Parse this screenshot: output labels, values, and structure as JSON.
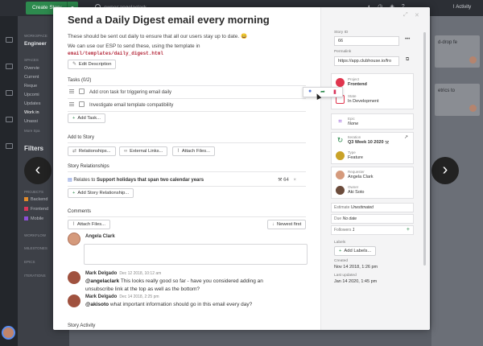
{
  "topbar": {
    "create_label": "Create Story",
    "search_query": "owner:angelaclark",
    "activity_label": "Activity"
  },
  "sidebar": {
    "workspace_heading": "WORKSPACE",
    "workspace_name": "Engineer",
    "spaces_heading": "SPACES",
    "spaces": [
      "Overvie",
      "Current",
      "Reque",
      "Upcomi",
      "Updates",
      "Work in",
      "Unassi",
      "More Spa"
    ],
    "filters_heading": "Filters",
    "projects_heading": "PROJECTS",
    "projects": [
      {
        "label": "Backend",
        "color": "#e08a2c"
      },
      {
        "label": "Frontend",
        "color": "#d9355b"
      },
      {
        "label": "Mobile",
        "color": "#8c4fd6"
      }
    ],
    "collapsed_headings": [
      "WORKFLOW",
      "MILESTONES",
      "EPICS",
      "ITERATIONS"
    ]
  },
  "board": {
    "cards": [
      {
        "text": "d-drop fe"
      },
      {
        "text": "etrics to"
      }
    ]
  },
  "story": {
    "title": "Send a Daily Digest email every morning",
    "description_line1": "These should be sent out daily to ensure that all our users stay up to date. 😀",
    "description_line2": "We can use our ESP to send these, using the template in",
    "description_code": "email/templates/daily_digest.html",
    "edit_description_label": "Edit Description",
    "tasks_heading": "Tasks (0/2)",
    "tasks": [
      {
        "label": "Add cron task for triggering email daily"
      },
      {
        "label": "Investigate email template compatibility"
      }
    ],
    "add_task_label": "Add Task...",
    "add_to_story_heading": "Add to Story",
    "add_to_story_buttons": [
      "Relationships...",
      "External Links...",
      "Attach Files..."
    ],
    "relationships_heading": "Story Relationships",
    "relationship": {
      "prefix": "Relates to",
      "target": "Support holidays that span two calendar years",
      "id": "64"
    },
    "add_relationship_label": "Add Story Relationship...",
    "comments_heading": "Comments",
    "attach_files_label": "Attach Files...",
    "sort_label": "Newest first",
    "composer_author": "Angela Clark",
    "comments": [
      {
        "author": "Mark Delgado",
        "date": "Dec 12 2018, 10:12 am",
        "mention": "@angelaclark",
        "text": " This looks really good so far - have you considered adding an unsubscribe link at the top as well as the bottom?"
      },
      {
        "author": "Mark Delgado",
        "date": "Dec 14 2018, 2:25 pm",
        "mention": "@akisoto",
        "text": " what important information should go in this email every day?"
      }
    ],
    "activity_heading": "Story Activity"
  },
  "details": {
    "story_id_label": "Story ID",
    "story_id": "66",
    "permalink_label": "Permalink",
    "permalink": "https://app.clubhouse.io/fro",
    "project_key": "Project",
    "project_value": "Frontend",
    "state_key": "State",
    "state_value": "In Development",
    "epic_key": "Epic",
    "epic_value": "None",
    "iteration_key": "Iteration",
    "iteration_value": "Q3 Week 10 2020",
    "type_key": "Type",
    "type_value": "Feature",
    "requester_key": "Requester",
    "requester_value": "Angela Clark",
    "owner_key": "Owner",
    "owner_value": "Aki Soto",
    "estimate_key": "Estimate",
    "estimate_value": "Unestimated",
    "due_key": "Due",
    "due_value": "No date",
    "followers_key": "Followers",
    "followers_value": "1",
    "labels_label": "Labels",
    "add_labels_label": "Add Labels...",
    "created_label": "Created",
    "created_value": "Nov 14 2018, 1:26 pm",
    "updated_label": "Last updated",
    "updated_value": "Jan 14 2020, 1:45 pm"
  },
  "colors": {
    "accent_green": "#2d8a4e",
    "frontend_red": "#e0354e",
    "feature_yellow": "#c9a227",
    "epic_purple": "#8c4fd6"
  }
}
